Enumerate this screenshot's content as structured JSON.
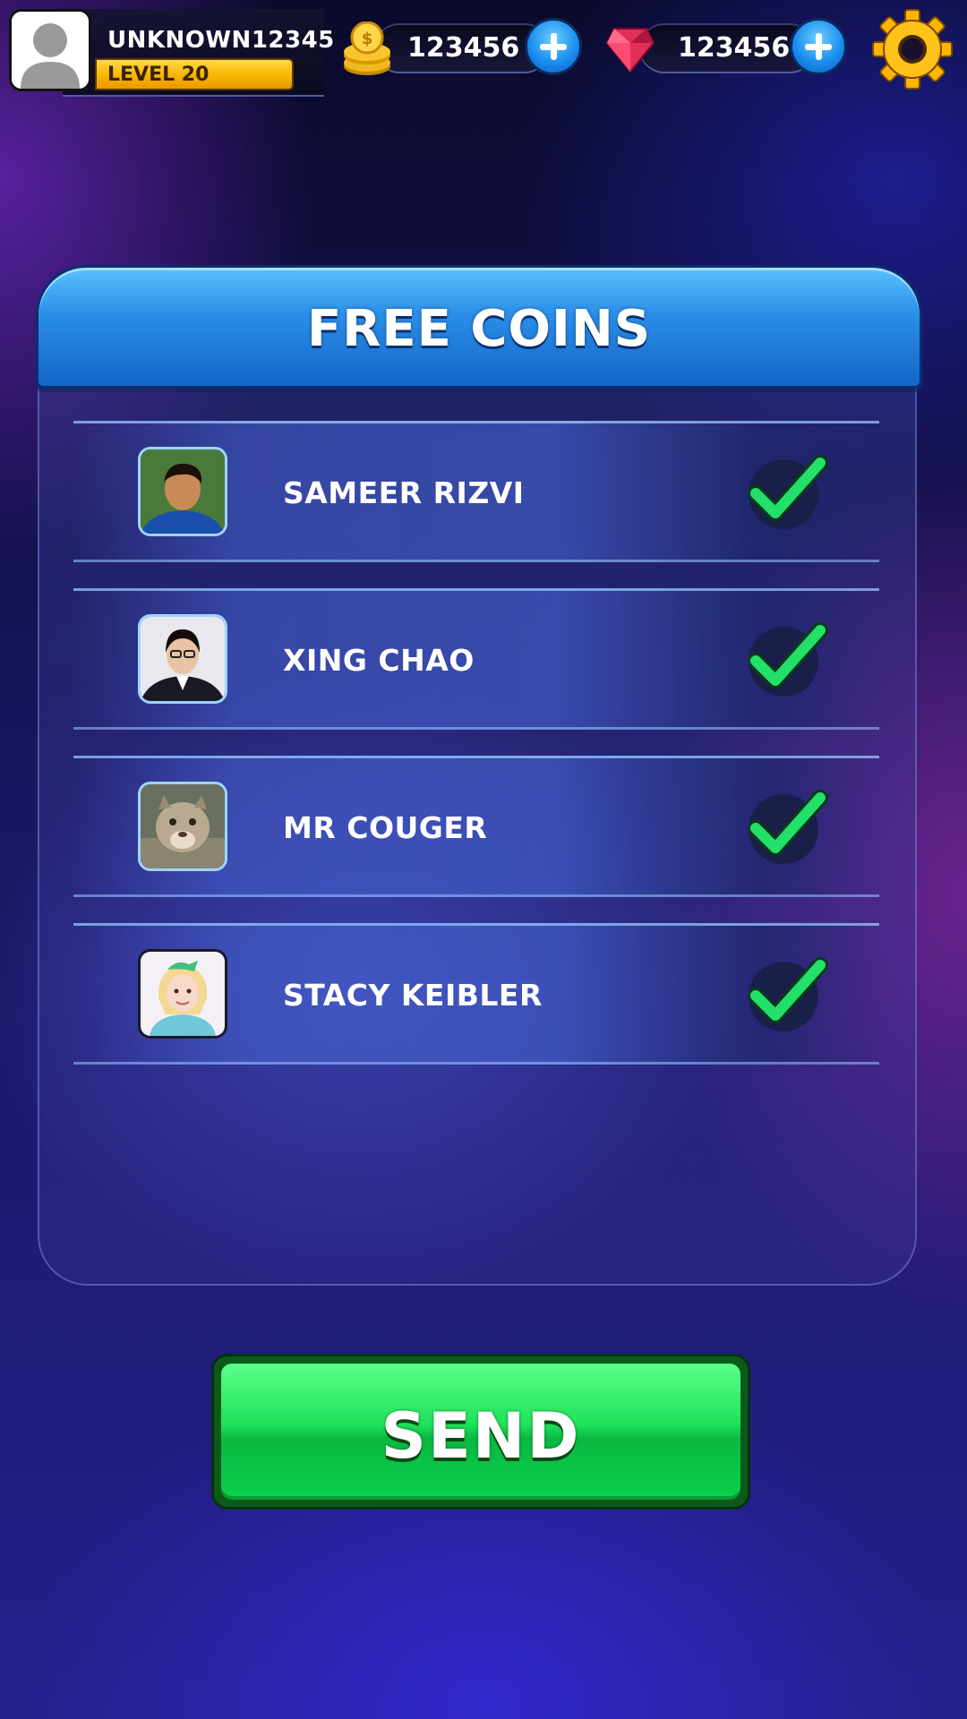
{
  "player": {
    "name": "UNKNOWN12345",
    "level": "LEVEL 20"
  },
  "currencies": {
    "coins": "123456",
    "gems": "123456"
  },
  "panel": {
    "title": "FREE COINS"
  },
  "friends": [
    {
      "name": "SAMEER RIZVI",
      "selected": true
    },
    {
      "name": "XING CHAO",
      "selected": true
    },
    {
      "name": "MR COUGER",
      "selected": true
    },
    {
      "name": "STACY KEIBLER",
      "selected": true
    }
  ],
  "send_button": {
    "label": "SEND"
  },
  "colors": {
    "accent_blue": "#2a8ee8",
    "check_green": "#22e06a",
    "send_green": "#1ee25a",
    "level_gold": "#f7b400"
  }
}
